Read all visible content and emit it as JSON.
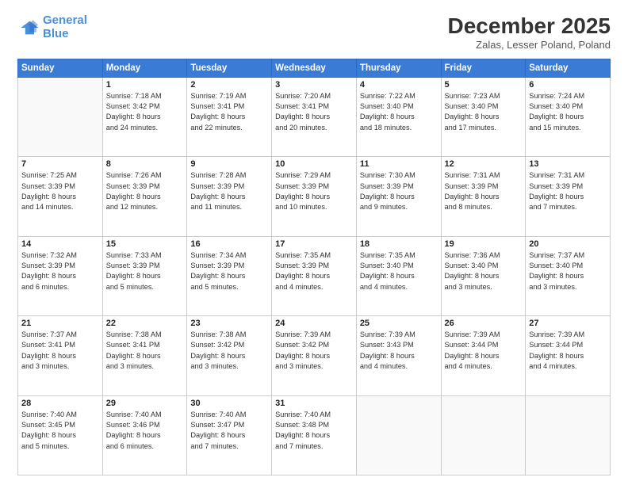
{
  "logo": {
    "line1": "General",
    "line2": "Blue"
  },
  "title": "December 2025",
  "location": "Zalas, Lesser Poland, Poland",
  "weekdays": [
    "Sunday",
    "Monday",
    "Tuesday",
    "Wednesday",
    "Thursday",
    "Friday",
    "Saturday"
  ],
  "weeks": [
    [
      {
        "day": "",
        "info": ""
      },
      {
        "day": "1",
        "info": "Sunrise: 7:18 AM\nSunset: 3:42 PM\nDaylight: 8 hours\nand 24 minutes."
      },
      {
        "day": "2",
        "info": "Sunrise: 7:19 AM\nSunset: 3:41 PM\nDaylight: 8 hours\nand 22 minutes."
      },
      {
        "day": "3",
        "info": "Sunrise: 7:20 AM\nSunset: 3:41 PM\nDaylight: 8 hours\nand 20 minutes."
      },
      {
        "day": "4",
        "info": "Sunrise: 7:22 AM\nSunset: 3:40 PM\nDaylight: 8 hours\nand 18 minutes."
      },
      {
        "day": "5",
        "info": "Sunrise: 7:23 AM\nSunset: 3:40 PM\nDaylight: 8 hours\nand 17 minutes."
      },
      {
        "day": "6",
        "info": "Sunrise: 7:24 AM\nSunset: 3:40 PM\nDaylight: 8 hours\nand 15 minutes."
      }
    ],
    [
      {
        "day": "7",
        "info": "Sunrise: 7:25 AM\nSunset: 3:39 PM\nDaylight: 8 hours\nand 14 minutes."
      },
      {
        "day": "8",
        "info": "Sunrise: 7:26 AM\nSunset: 3:39 PM\nDaylight: 8 hours\nand 12 minutes."
      },
      {
        "day": "9",
        "info": "Sunrise: 7:28 AM\nSunset: 3:39 PM\nDaylight: 8 hours\nand 11 minutes."
      },
      {
        "day": "10",
        "info": "Sunrise: 7:29 AM\nSunset: 3:39 PM\nDaylight: 8 hours\nand 10 minutes."
      },
      {
        "day": "11",
        "info": "Sunrise: 7:30 AM\nSunset: 3:39 PM\nDaylight: 8 hours\nand 9 minutes."
      },
      {
        "day": "12",
        "info": "Sunrise: 7:31 AM\nSunset: 3:39 PM\nDaylight: 8 hours\nand 8 minutes."
      },
      {
        "day": "13",
        "info": "Sunrise: 7:31 AM\nSunset: 3:39 PM\nDaylight: 8 hours\nand 7 minutes."
      }
    ],
    [
      {
        "day": "14",
        "info": "Sunrise: 7:32 AM\nSunset: 3:39 PM\nDaylight: 8 hours\nand 6 minutes."
      },
      {
        "day": "15",
        "info": "Sunrise: 7:33 AM\nSunset: 3:39 PM\nDaylight: 8 hours\nand 5 minutes."
      },
      {
        "day": "16",
        "info": "Sunrise: 7:34 AM\nSunset: 3:39 PM\nDaylight: 8 hours\nand 5 minutes."
      },
      {
        "day": "17",
        "info": "Sunrise: 7:35 AM\nSunset: 3:39 PM\nDaylight: 8 hours\nand 4 minutes."
      },
      {
        "day": "18",
        "info": "Sunrise: 7:35 AM\nSunset: 3:40 PM\nDaylight: 8 hours\nand 4 minutes."
      },
      {
        "day": "19",
        "info": "Sunrise: 7:36 AM\nSunset: 3:40 PM\nDaylight: 8 hours\nand 3 minutes."
      },
      {
        "day": "20",
        "info": "Sunrise: 7:37 AM\nSunset: 3:40 PM\nDaylight: 8 hours\nand 3 minutes."
      }
    ],
    [
      {
        "day": "21",
        "info": "Sunrise: 7:37 AM\nSunset: 3:41 PM\nDaylight: 8 hours\nand 3 minutes."
      },
      {
        "day": "22",
        "info": "Sunrise: 7:38 AM\nSunset: 3:41 PM\nDaylight: 8 hours\nand 3 minutes."
      },
      {
        "day": "23",
        "info": "Sunrise: 7:38 AM\nSunset: 3:42 PM\nDaylight: 8 hours\nand 3 minutes."
      },
      {
        "day": "24",
        "info": "Sunrise: 7:39 AM\nSunset: 3:42 PM\nDaylight: 8 hours\nand 3 minutes."
      },
      {
        "day": "25",
        "info": "Sunrise: 7:39 AM\nSunset: 3:43 PM\nDaylight: 8 hours\nand 4 minutes."
      },
      {
        "day": "26",
        "info": "Sunrise: 7:39 AM\nSunset: 3:44 PM\nDaylight: 8 hours\nand 4 minutes."
      },
      {
        "day": "27",
        "info": "Sunrise: 7:39 AM\nSunset: 3:44 PM\nDaylight: 8 hours\nand 4 minutes."
      }
    ],
    [
      {
        "day": "28",
        "info": "Sunrise: 7:40 AM\nSunset: 3:45 PM\nDaylight: 8 hours\nand 5 minutes."
      },
      {
        "day": "29",
        "info": "Sunrise: 7:40 AM\nSunset: 3:46 PM\nDaylight: 8 hours\nand 6 minutes."
      },
      {
        "day": "30",
        "info": "Sunrise: 7:40 AM\nSunset: 3:47 PM\nDaylight: 8 hours\nand 7 minutes."
      },
      {
        "day": "31",
        "info": "Sunrise: 7:40 AM\nSunset: 3:48 PM\nDaylight: 8 hours\nand 7 minutes."
      },
      {
        "day": "",
        "info": ""
      },
      {
        "day": "",
        "info": ""
      },
      {
        "day": "",
        "info": ""
      }
    ]
  ]
}
